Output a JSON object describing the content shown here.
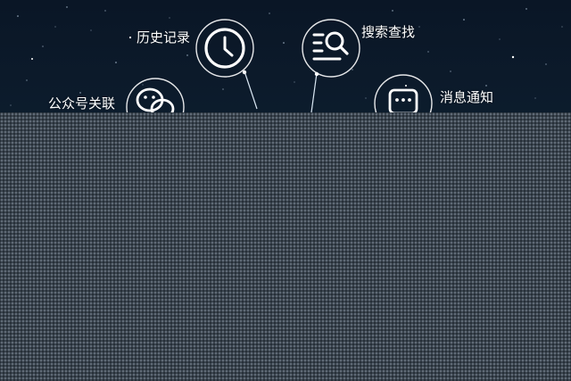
{
  "labels": {
    "history": "历史记录",
    "search": "搜索查找",
    "official_account": "公众号关联",
    "message": "消息通知"
  },
  "icons": {
    "history": "clock-icon",
    "search": "search-list-icon",
    "official_account": "chat-bubble-icon",
    "message": "message-dots-icon"
  },
  "colors": {
    "background": "#0c1a2a",
    "icon_stroke": "#ffffff",
    "overlay": "#3a444e"
  }
}
